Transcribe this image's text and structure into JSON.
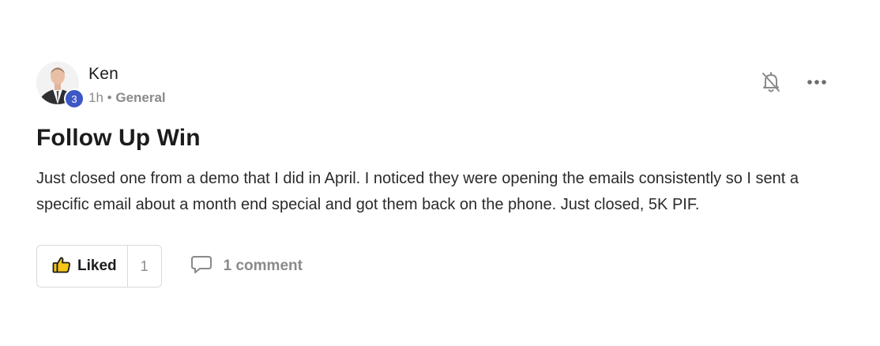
{
  "post": {
    "author": "Ken",
    "level": "3",
    "time": "1h",
    "separator": "•",
    "category": "General",
    "title": "Follow Up Win",
    "body": "Just closed one from a demo that I did in April. I noticed they were opening the emails consistently so I sent a specific email about a month end special and got them back on the phone. Just closed, 5K PIF."
  },
  "actions": {
    "like_label": "Liked",
    "like_count": "1",
    "comment_label": "1 comment"
  },
  "icons": {
    "bell": "bell-off-icon",
    "more": "more-horizontal-icon",
    "like": "thumbs-up-icon",
    "comment": "comment-icon"
  },
  "colors": {
    "badge": "#3d57c4",
    "muted": "#8a8a8a",
    "text": "#1c1c1c"
  }
}
